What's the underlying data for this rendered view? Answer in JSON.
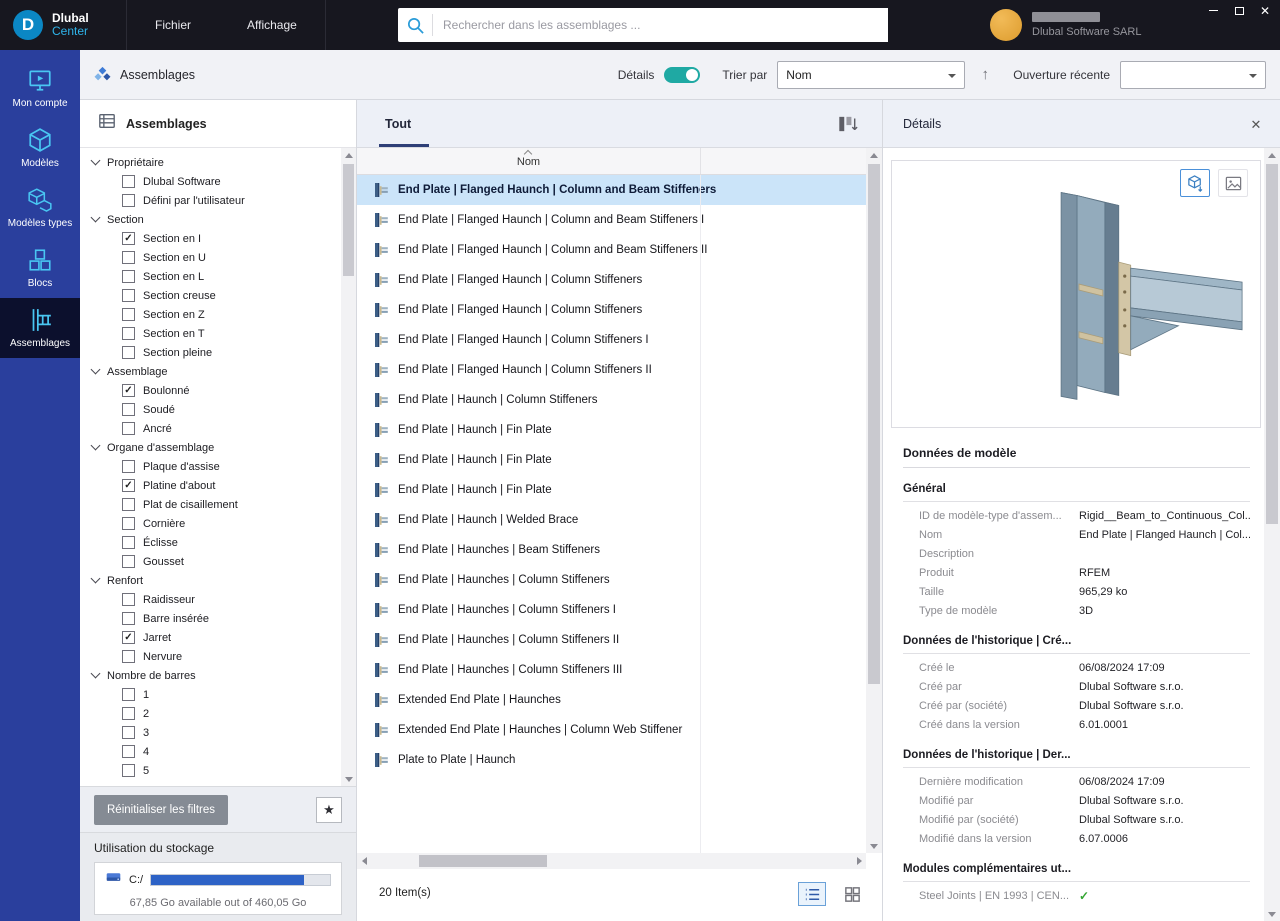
{
  "window": {
    "brand_top": "Dlubal",
    "brand_bottom": "Center",
    "menus": [
      "Fichier",
      "Affichage"
    ],
    "search_placeholder": "Rechercher dans les assemblages ...",
    "user_company": "Dlubal Software SARL"
  },
  "icons": {
    "sort_ascending": "↑",
    "close": "✕",
    "star": "★"
  },
  "colors": {
    "accent_cyan": "#29abe2",
    "sidebar_blue": "#2a3f9d",
    "toggle_teal": "#1fa9a3",
    "selection_blue": "#cbe4f9",
    "progress_blue": "#2d62c6",
    "check_green": "#33a532"
  },
  "toolbar": {
    "breadcrumb": "Assemblages",
    "details_label": "Détails",
    "details_on": true,
    "sort_label": "Trier par",
    "sort_value": "Nom",
    "recent_label": "Ouverture récente",
    "recent_value": ""
  },
  "sidebar": {
    "items": [
      {
        "label": "Mon compte",
        "icon": "monitor",
        "active": false
      },
      {
        "label": "Modèles",
        "icon": "cube",
        "active": false
      },
      {
        "label": "Modèles types",
        "icon": "cubes",
        "active": false
      },
      {
        "label": "Blocs",
        "icon": "blocks",
        "active": false
      },
      {
        "label": "Assemblages",
        "icon": "assembly",
        "active": true
      }
    ]
  },
  "filters": {
    "title": "Assemblages",
    "groups": [
      {
        "label": "Propriétaire",
        "items": [
          {
            "label": "Dlubal Software",
            "checked": false
          },
          {
            "label": "Défini par l'utilisateur",
            "checked": false
          }
        ]
      },
      {
        "label": "Section",
        "items": [
          {
            "label": "Section en I",
            "checked": true
          },
          {
            "label": "Section en U",
            "checked": false
          },
          {
            "label": "Section en L",
            "checked": false
          },
          {
            "label": "Section creuse",
            "checked": false
          },
          {
            "label": "Section en Z",
            "checked": false
          },
          {
            "label": "Section en T",
            "checked": false
          },
          {
            "label": "Section pleine",
            "checked": false
          }
        ]
      },
      {
        "label": "Assemblage",
        "items": [
          {
            "label": "Boulonné",
            "checked": true
          },
          {
            "label": "Soudé",
            "checked": false
          },
          {
            "label": "Ancré",
            "checked": false
          }
        ]
      },
      {
        "label": "Organe d'assemblage",
        "items": [
          {
            "label": "Plaque d'assise",
            "checked": false
          },
          {
            "label": "Platine d'about",
            "checked": true
          },
          {
            "label": "Plat de cisaillement",
            "checked": false
          },
          {
            "label": "Cornière",
            "checked": false
          },
          {
            "label": "Éclisse",
            "checked": false
          },
          {
            "label": "Gousset",
            "checked": false
          }
        ]
      },
      {
        "label": "Renfort",
        "items": [
          {
            "label": "Raidisseur",
            "checked": false
          },
          {
            "label": "Barre insérée",
            "checked": false
          },
          {
            "label": "Jarret",
            "checked": true
          },
          {
            "label": "Nervure",
            "checked": false
          }
        ]
      },
      {
        "label": "Nombre de barres",
        "items": [
          {
            "label": "1",
            "checked": false
          },
          {
            "label": "2",
            "checked": false
          },
          {
            "label": "3",
            "checked": false
          },
          {
            "label": "4",
            "checked": false
          },
          {
            "label": "5",
            "checked": false
          }
        ]
      }
    ],
    "reset_button": "Réinitialiser les filtres",
    "storage": {
      "title": "Utilisation du stockage",
      "drive": "C:/",
      "info": "67,85 Go available out of 460,05 Go",
      "used_percent": 85.3
    }
  },
  "list": {
    "tab": "Tout",
    "column": "Nom",
    "status": "20 Item(s)",
    "items": [
      {
        "name": "End Plate | Flanged Haunch | Column and Beam Stiffeners",
        "selected": true
      },
      {
        "name": "End Plate | Flanged Haunch | Column and Beam Stiffeners I",
        "selected": false
      },
      {
        "name": "End Plate | Flanged Haunch | Column and Beam Stiffeners II",
        "selected": false
      },
      {
        "name": "End Plate | Flanged Haunch | Column Stiffeners",
        "selected": false
      },
      {
        "name": "End Plate | Flanged Haunch | Column Stiffeners",
        "selected": false
      },
      {
        "name": "End Plate | Flanged Haunch | Column Stiffeners I",
        "selected": false
      },
      {
        "name": "End Plate | Flanged Haunch | Column Stiffeners II",
        "selected": false
      },
      {
        "name": "End Plate | Haunch | Column Stiffeners",
        "selected": false
      },
      {
        "name": "End Plate | Haunch | Fin Plate",
        "selected": false
      },
      {
        "name": "End Plate | Haunch | Fin Plate",
        "selected": false
      },
      {
        "name": "End Plate | Haunch | Fin Plate",
        "selected": false
      },
      {
        "name": "End Plate | Haunch | Welded Brace",
        "selected": false
      },
      {
        "name": "End Plate | Haunches | Beam Stiffeners",
        "selected": false
      },
      {
        "name": "End Plate | Haunches | Column Stiffeners",
        "selected": false
      },
      {
        "name": "End Plate | Haunches | Column Stiffeners I",
        "selected": false
      },
      {
        "name": "End Plate | Haunches | Column Stiffeners II",
        "selected": false
      },
      {
        "name": "End Plate | Haunches | Column Stiffeners III",
        "selected": false
      },
      {
        "name": "Extended End Plate | Haunches",
        "selected": false
      },
      {
        "name": "Extended End Plate | Haunches | Column Web Stiffener",
        "selected": false
      },
      {
        "name": "Plate to Plate | Haunch",
        "selected": false
      }
    ]
  },
  "details": {
    "title": "Détails",
    "section_title": "Données de modèle",
    "groups": [
      {
        "title": "Général",
        "rows": [
          {
            "label": "ID de modèle-type d'assem...",
            "value": "Rigid__Beam_to_Continuous_Col..."
          },
          {
            "label": "Nom",
            "value": "End Plate | Flanged Haunch | Col..."
          },
          {
            "label": "Description",
            "value": ""
          },
          {
            "label": "Produit",
            "value": "RFEM"
          },
          {
            "label": "Taille",
            "value": "965,29 ko"
          },
          {
            "label": "Type de modèle",
            "value": "3D"
          }
        ]
      },
      {
        "title": "Données de l'historique | Cré...",
        "rows": [
          {
            "label": "Créé le",
            "value": "06/08/2024 17:09"
          },
          {
            "label": "Créé par",
            "value": "Dlubal Software s.r.o."
          },
          {
            "label": "Créé par (société)",
            "value": "Dlubal Software s.r.o."
          },
          {
            "label": "Créé dans la version",
            "value": "6.01.0001"
          }
        ]
      },
      {
        "title": "Données de l'historique | Der...",
        "rows": [
          {
            "label": "Dernière modification",
            "value": "06/08/2024 17:09"
          },
          {
            "label": "Modifié par",
            "value": "Dlubal Software s.r.o."
          },
          {
            "label": "Modifié par (société)",
            "value": "Dlubal Software s.r.o."
          },
          {
            "label": "Modifié dans la version",
            "value": "6.07.0006"
          }
        ]
      },
      {
        "title": "Modules complémentaires ut...",
        "rows": [
          {
            "label": "Steel Joints | EN 1993 | CEN...",
            "value": "✓",
            "check": true
          }
        ]
      }
    ]
  }
}
